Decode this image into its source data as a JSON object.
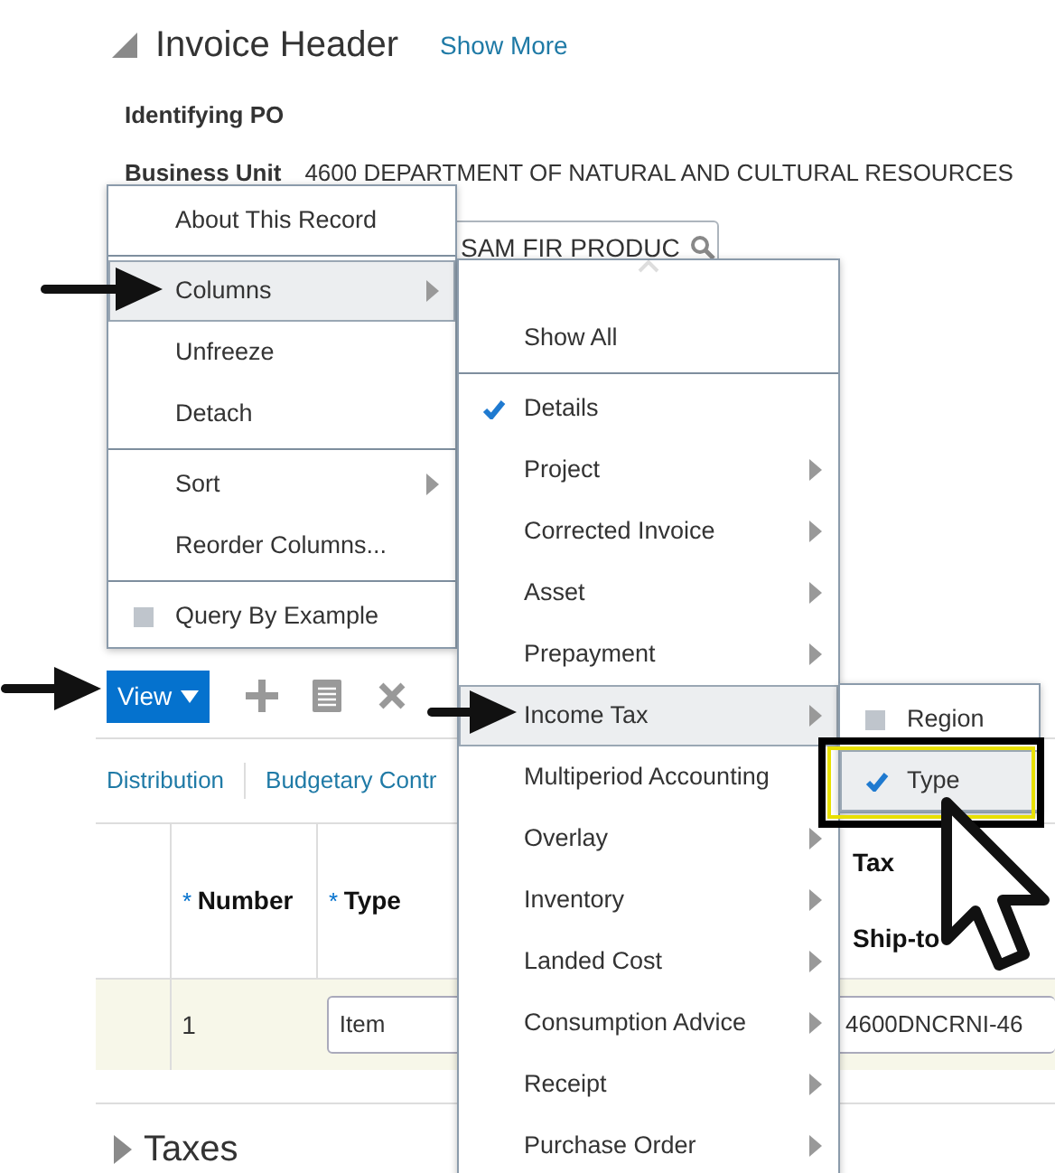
{
  "header": {
    "title": "Invoice Header",
    "link": "Show More",
    "expanded": true
  },
  "fields": [
    {
      "label": "Identifying PO"
    },
    {
      "label": "Business Unit",
      "value": "4600 DEPARTMENT OF NATURAL AND CULTURAL RESOURCES"
    }
  ],
  "supplier_field": {
    "value": "SAM FIR PRODUC"
  },
  "toolbar": {
    "view_label": "View"
  },
  "tabs": [
    "Distribution",
    "Budgetary Contr"
  ],
  "table": {
    "columns": [
      {
        "label": "Number",
        "required_mark": "*"
      },
      {
        "label": "Type",
        "required_mark": "*"
      }
    ],
    "right_columns": {
      "group": "Tax",
      "label": "Ship-to"
    },
    "rows": [
      {
        "number": "1",
        "type": "Item",
        "ship_to": "4600DNCRNI-46"
      }
    ]
  },
  "section": {
    "title": "Taxes",
    "expanded": false
  },
  "context_menu": [
    {
      "label": "About This Record",
      "kind": "item",
      "selected": false,
      "divider_before": false
    },
    {
      "label": "Columns",
      "kind": "submenu",
      "selected": true,
      "divider_before": true
    },
    {
      "label": "Unfreeze",
      "kind": "item",
      "selected": false,
      "divider_before": false
    },
    {
      "label": "Detach",
      "kind": "item",
      "selected": false,
      "divider_before": false
    },
    {
      "label": "Sort",
      "kind": "submenu",
      "selected": false,
      "divider_before": true
    },
    {
      "label": "Reorder Columns...",
      "kind": "item",
      "selected": false,
      "divider_before": false
    },
    {
      "label": "Query By Example",
      "kind": "checkbox",
      "checked": false,
      "selected": false,
      "divider_before": true
    }
  ],
  "columns_menu": [
    {
      "label": "Show All",
      "kind": "item",
      "selected": false,
      "divider_before": false
    },
    {
      "label": "Details",
      "kind": "checkbox",
      "checked": true,
      "selected": false,
      "divider_before": true
    },
    {
      "label": "Project",
      "kind": "submenu",
      "selected": false,
      "divider_before": false
    },
    {
      "label": "Corrected Invoice",
      "kind": "submenu",
      "selected": false,
      "divider_before": false
    },
    {
      "label": "Asset",
      "kind": "submenu",
      "selected": false,
      "divider_before": false
    },
    {
      "label": "Prepayment",
      "kind": "submenu",
      "selected": false,
      "divider_before": false
    },
    {
      "label": "Income Tax",
      "kind": "submenu",
      "selected": true,
      "divider_before": false
    },
    {
      "label": "Multiperiod Accounting",
      "kind": "item",
      "selected": false,
      "divider_before": false
    },
    {
      "label": "Overlay",
      "kind": "submenu",
      "selected": false,
      "divider_before": false
    },
    {
      "label": "Inventory",
      "kind": "submenu",
      "selected": false,
      "divider_before": false
    },
    {
      "label": "Landed Cost",
      "kind": "submenu",
      "selected": false,
      "divider_before": false
    },
    {
      "label": "Consumption Advice",
      "kind": "submenu",
      "selected": false,
      "divider_before": false
    },
    {
      "label": "Receipt",
      "kind": "submenu",
      "selected": false,
      "divider_before": false
    },
    {
      "label": "Purchase Order",
      "kind": "submenu",
      "selected": false,
      "divider_before": false
    }
  ],
  "income_tax_menu": [
    {
      "label": "Region",
      "kind": "checkbox",
      "checked": false,
      "selected": false,
      "divider_before": false
    },
    {
      "label": "Type",
      "kind": "checkbox",
      "checked": true,
      "selected": true,
      "divider_before": false
    }
  ]
}
